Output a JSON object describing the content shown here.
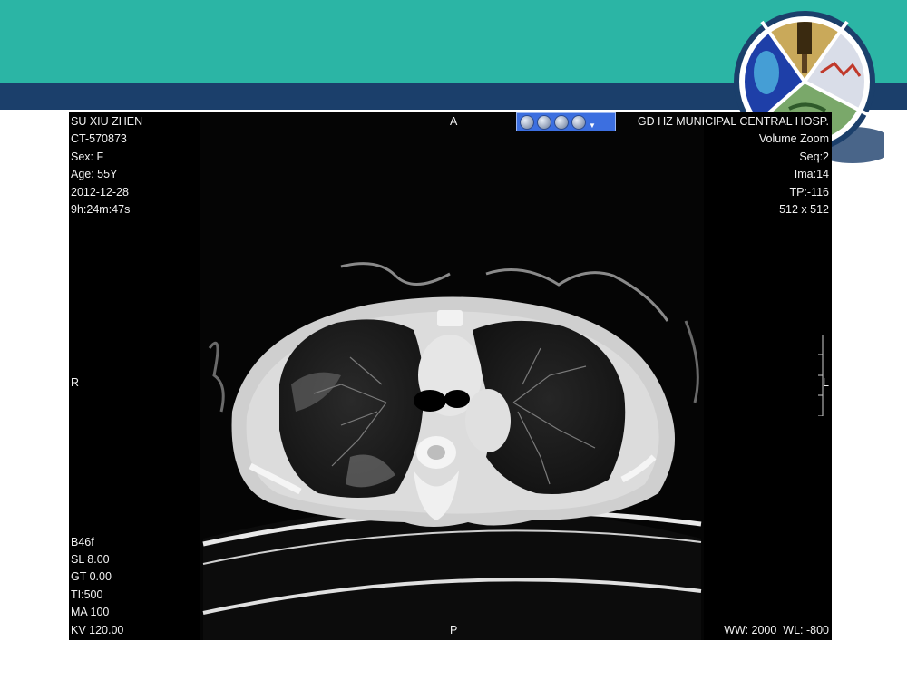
{
  "slide": {
    "colors": {
      "teal": "#2bb5a5",
      "navy": "#1b3f6b"
    }
  },
  "viewer": {
    "patient": {
      "name": "SU XIU ZHEN",
      "id": "CT-570873",
      "sex": "Sex: F",
      "age": "Age: 55Y",
      "date": "2012-12-28",
      "time": "9h:24m:47s"
    },
    "site": {
      "hospital": "GD HZ MUNICIPAL CENTRAL HOSP.",
      "mode": "Volume Zoom",
      "seq": "Seq:2",
      "ima": "Ima:14",
      "tp": "TP:-116",
      "matrix": "512 x 512"
    },
    "orientation": {
      "top": "A",
      "bottom": "P",
      "left": "R",
      "right": "L"
    },
    "params": {
      "kernel": "B46f",
      "sl": "SL 8.00",
      "gt": "GT 0.00",
      "ti": "TI:500",
      "ma": "MA 100",
      "kv": "KV 120.00"
    },
    "window": "WW: 2000  WL: -800",
    "toolbar_icons": [
      "circle-button-icon",
      "circle-button-icon",
      "circle-button-icon",
      "circle-button-icon",
      "dropdown-arrow-icon"
    ]
  }
}
